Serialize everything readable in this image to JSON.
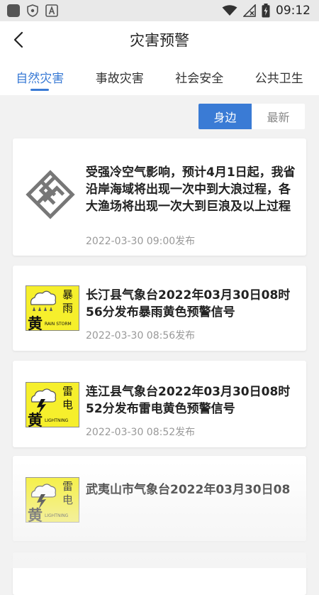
{
  "status_bar": {
    "time": "09:12"
  },
  "header": {
    "title": "灾害预警"
  },
  "tabs": [
    {
      "label": "自然灾害",
      "active": true
    },
    {
      "label": "事故灾害",
      "active": false
    },
    {
      "label": "社会安全",
      "active": false
    },
    {
      "label": "公共卫生",
      "active": false
    }
  ],
  "filter": {
    "nearby": "身边",
    "latest": "最新"
  },
  "warnings": [
    {
      "icon": "ocean-administration-logo-icon",
      "text": "受强冷空气影响，预计4月1日起，我省沿岸海域将出现一次中到大浪过程，各大渔场将出现一次大到巨浪及以上过程",
      "time": "2022-03-30 09:00发布"
    },
    {
      "icon": "rainstorm-yellow-warning-icon",
      "icon_big_char": "黄",
      "icon_chars": "暴雨",
      "icon_caption": "RAIN STORM",
      "text": "长汀县气象台2022年03月30日08时56分发布暴雨黄色预警信号",
      "time": "2022-03-30 08:56发布"
    },
    {
      "icon": "lightning-yellow-warning-icon",
      "icon_big_char": "黄",
      "icon_chars": "雷电",
      "icon_caption": "LIGHTNING",
      "text": "连江县气象台2022年03月30日08时52分发布雷电黄色预警信号",
      "time": "2022-03-30 08:52发布"
    },
    {
      "icon": "lightning-yellow-warning-icon",
      "icon_big_char": "黄",
      "icon_chars": "雷电",
      "icon_caption": "LIGHTNING",
      "text": "武夷山市气象台2022年03月30日08"
    }
  ],
  "colors": {
    "accent": "#3a7bd5",
    "warning_yellow": "#f6ef2c",
    "background": "#f2f2f2"
  }
}
